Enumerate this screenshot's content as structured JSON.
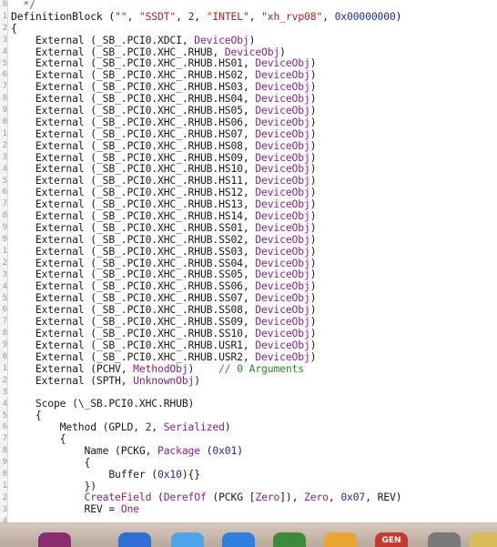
{
  "gutter_numbers": [
    "0",
    "1",
    "2",
    "3",
    "4",
    "5",
    "6",
    "7",
    "8",
    "9",
    "0",
    "1",
    "2",
    "3",
    "4",
    "5",
    "6",
    "7",
    "8",
    "9",
    "0",
    "1",
    "2",
    "3",
    "4",
    "5",
    "6",
    "7",
    "8",
    "9",
    "0",
    "1",
    "2",
    "3",
    "4",
    "5",
    "6",
    "7",
    "8",
    "9",
    "0",
    "1",
    "2",
    "3",
    "4",
    "5"
  ],
  "lines": [
    [
      {
        "t": "  */",
        "c": "comment"
      }
    ],
    [
      {
        "t": "DefinitionBlock (",
        "c": "kw"
      },
      {
        "t": "\"\"",
        "c": "str"
      },
      {
        "t": ", ",
        "c": "plain"
      },
      {
        "t": "\"SSDT\"",
        "c": "str"
      },
      {
        "t": ", ",
        "c": "plain"
      },
      {
        "t": "2",
        "c": "num"
      },
      {
        "t": ", ",
        "c": "plain"
      },
      {
        "t": "\"INTEL\"",
        "c": "str"
      },
      {
        "t": ", ",
        "c": "plain"
      },
      {
        "t": "\"xh_rvp08\"",
        "c": "str"
      },
      {
        "t": ", ",
        "c": "plain"
      },
      {
        "t": "0x00000000",
        "c": "num"
      },
      {
        "t": ")",
        "c": "plain"
      }
    ],
    [
      {
        "t": "{",
        "c": "plain"
      }
    ],
    [
      {
        "t": "    External (_SB_.PCI0.XDCI, ",
        "c": "plain"
      },
      {
        "t": "DeviceObj",
        "c": "type"
      },
      {
        "t": ")",
        "c": "plain"
      }
    ],
    [
      {
        "t": "    External (_SB_.PCI0.XHC_.RHUB, ",
        "c": "plain"
      },
      {
        "t": "DeviceObj",
        "c": "type"
      },
      {
        "t": ")",
        "c": "plain"
      }
    ],
    [
      {
        "t": "    External (_SB_.PCI0.XHC_.RHUB.HS01, ",
        "c": "plain"
      },
      {
        "t": "DeviceObj",
        "c": "type"
      },
      {
        "t": ")",
        "c": "plain"
      }
    ],
    [
      {
        "t": "    External (_SB_.PCI0.XHC_.RHUB.HS02, ",
        "c": "plain"
      },
      {
        "t": "DeviceObj",
        "c": "type"
      },
      {
        "t": ")",
        "c": "plain"
      }
    ],
    [
      {
        "t": "    External (_SB_.PCI0.XHC_.RHUB.HS03, ",
        "c": "plain"
      },
      {
        "t": "DeviceObj",
        "c": "type"
      },
      {
        "t": ")",
        "c": "plain"
      }
    ],
    [
      {
        "t": "    External (_SB_.PCI0.XHC_.RHUB.HS04, ",
        "c": "plain"
      },
      {
        "t": "DeviceObj",
        "c": "type"
      },
      {
        "t": ")",
        "c": "plain"
      }
    ],
    [
      {
        "t": "    External (_SB_.PCI0.XHC_.RHUB.HS05, ",
        "c": "plain"
      },
      {
        "t": "DeviceObj",
        "c": "type"
      },
      {
        "t": ")",
        "c": "plain"
      }
    ],
    [
      {
        "t": "    External (_SB_.PCI0.XHC_.RHUB.HS06, ",
        "c": "plain"
      },
      {
        "t": "DeviceObj",
        "c": "type"
      },
      {
        "t": ")",
        "c": "plain"
      }
    ],
    [
      {
        "t": "    External (_SB_.PCI0.XHC_.RHUB.HS07, ",
        "c": "plain"
      },
      {
        "t": "DeviceObj",
        "c": "type"
      },
      {
        "t": ")",
        "c": "plain"
      }
    ],
    [
      {
        "t": "    External (_SB_.PCI0.XHC_.RHUB.HS08, ",
        "c": "plain"
      },
      {
        "t": "DeviceObj",
        "c": "type"
      },
      {
        "t": ")",
        "c": "plain"
      }
    ],
    [
      {
        "t": "    External (_SB_.PCI0.XHC_.RHUB.HS09, ",
        "c": "plain"
      },
      {
        "t": "DeviceObj",
        "c": "type"
      },
      {
        "t": ")",
        "c": "plain"
      }
    ],
    [
      {
        "t": "    External (_SB_.PCI0.XHC_.RHUB.HS10, ",
        "c": "plain"
      },
      {
        "t": "DeviceObj",
        "c": "type"
      },
      {
        "t": ")",
        "c": "plain"
      }
    ],
    [
      {
        "t": "    External (_SB_.PCI0.XHC_.RHUB.HS11, ",
        "c": "plain"
      },
      {
        "t": "DeviceObj",
        "c": "type"
      },
      {
        "t": ")",
        "c": "plain"
      }
    ],
    [
      {
        "t": "    External (_SB_.PCI0.XHC_.RHUB.HS12, ",
        "c": "plain"
      },
      {
        "t": "DeviceObj",
        "c": "type"
      },
      {
        "t": ")",
        "c": "plain"
      }
    ],
    [
      {
        "t": "    External (_SB_.PCI0.XHC_.RHUB.HS13, ",
        "c": "plain"
      },
      {
        "t": "DeviceObj",
        "c": "type"
      },
      {
        "t": ")",
        "c": "plain"
      }
    ],
    [
      {
        "t": "    External (_SB_.PCI0.XHC_.RHUB.HS14, ",
        "c": "plain"
      },
      {
        "t": "DeviceObj",
        "c": "type"
      },
      {
        "t": ")",
        "c": "plain"
      }
    ],
    [
      {
        "t": "    External (_SB_.PCI0.XHC_.RHUB.SS01, ",
        "c": "plain"
      },
      {
        "t": "DeviceObj",
        "c": "type"
      },
      {
        "t": ")",
        "c": "plain"
      }
    ],
    [
      {
        "t": "    External (_SB_.PCI0.XHC_.RHUB.SS02, ",
        "c": "plain"
      },
      {
        "t": "DeviceObj",
        "c": "type"
      },
      {
        "t": ")",
        "c": "plain"
      }
    ],
    [
      {
        "t": "    External (_SB_.PCI0.XHC_.RHUB.SS03, ",
        "c": "plain"
      },
      {
        "t": "DeviceObj",
        "c": "type"
      },
      {
        "t": ")",
        "c": "plain"
      }
    ],
    [
      {
        "t": "    External (_SB_.PCI0.XHC_.RHUB.SS04, ",
        "c": "plain"
      },
      {
        "t": "DeviceObj",
        "c": "type"
      },
      {
        "t": ")",
        "c": "plain"
      }
    ],
    [
      {
        "t": "    External (_SB_.PCI0.XHC_.RHUB.SS05, ",
        "c": "plain"
      },
      {
        "t": "DeviceObj",
        "c": "type"
      },
      {
        "t": ")",
        "c": "plain"
      }
    ],
    [
      {
        "t": "    External (_SB_.PCI0.XHC_.RHUB.SS06, ",
        "c": "plain"
      },
      {
        "t": "DeviceObj",
        "c": "type"
      },
      {
        "t": ")",
        "c": "plain"
      }
    ],
    [
      {
        "t": "    External (_SB_.PCI0.XHC_.RHUB.SS07, ",
        "c": "plain"
      },
      {
        "t": "DeviceObj",
        "c": "type"
      },
      {
        "t": ")",
        "c": "plain"
      }
    ],
    [
      {
        "t": "    External (_SB_.PCI0.XHC_.RHUB.SS08, ",
        "c": "plain"
      },
      {
        "t": "DeviceObj",
        "c": "type"
      },
      {
        "t": ")",
        "c": "plain"
      }
    ],
    [
      {
        "t": "    External (_SB_.PCI0.XHC_.RHUB.SS09, ",
        "c": "plain"
      },
      {
        "t": "DeviceObj",
        "c": "type"
      },
      {
        "t": ")",
        "c": "plain"
      }
    ],
    [
      {
        "t": "    External (_SB_.PCI0.XHC_.RHUB.SS10, ",
        "c": "plain"
      },
      {
        "t": "DeviceObj",
        "c": "type"
      },
      {
        "t": ")",
        "c": "plain"
      }
    ],
    [
      {
        "t": "    External (_SB_.PCI0.XHC_.RHUB.USR1, ",
        "c": "plain"
      },
      {
        "t": "DeviceObj",
        "c": "type"
      },
      {
        "t": ")",
        "c": "plain"
      }
    ],
    [
      {
        "t": "    External (_SB_.PCI0.XHC_.RHUB.USR2, ",
        "c": "plain"
      },
      {
        "t": "DeviceObj",
        "c": "type"
      },
      {
        "t": ")",
        "c": "plain"
      }
    ],
    [
      {
        "t": "    External (PCHV, ",
        "c": "plain"
      },
      {
        "t": "MethodObj",
        "c": "type"
      },
      {
        "t": ")    ",
        "c": "plain"
      },
      {
        "t": "// 0 Arguments",
        "c": "comment"
      }
    ],
    [
      {
        "t": "    External (SPTH, ",
        "c": "plain"
      },
      {
        "t": "UnknownObj",
        "c": "type"
      },
      {
        "t": ")",
        "c": "plain"
      }
    ],
    [
      {
        "t": "",
        "c": "plain"
      }
    ],
    [
      {
        "t": "    Scope (\\_SB.PCI0.XHC.RHUB)",
        "c": "plain"
      }
    ],
    [
      {
        "t": "    {",
        "c": "plain"
      }
    ],
    [
      {
        "t": "        Method (GPLD, ",
        "c": "plain"
      },
      {
        "t": "2",
        "c": "num"
      },
      {
        "t": ", ",
        "c": "plain"
      },
      {
        "t": "Serialized",
        "c": "type"
      },
      {
        "t": ")",
        "c": "plain"
      }
    ],
    [
      {
        "t": "        {",
        "c": "plain"
      }
    ],
    [
      {
        "t": "            Name (PCKG, ",
        "c": "plain"
      },
      {
        "t": "Package",
        "c": "type"
      },
      {
        "t": " (",
        "c": "plain"
      },
      {
        "t": "0x01",
        "c": "num"
      },
      {
        "t": ")",
        "c": "plain"
      }
    ],
    [
      {
        "t": "            {",
        "c": "plain"
      }
    ],
    [
      {
        "t": "                Buffer (",
        "c": "plain"
      },
      {
        "t": "0x10",
        "c": "num"
      },
      {
        "t": "){}",
        "c": "plain"
      }
    ],
    [
      {
        "t": "            })",
        "c": "plain"
      }
    ],
    [
      {
        "t": "            ",
        "c": "plain"
      },
      {
        "t": "CreateField",
        "c": "type"
      },
      {
        "t": " (",
        "c": "plain"
      },
      {
        "t": "DerefOf",
        "c": "type"
      },
      {
        "t": " (PCKG [",
        "c": "plain"
      },
      {
        "t": "Zero",
        "c": "type"
      },
      {
        "t": "]), ",
        "c": "plain"
      },
      {
        "t": "Zero",
        "c": "type"
      },
      {
        "t": ", ",
        "c": "plain"
      },
      {
        "t": "0x07",
        "c": "num"
      },
      {
        "t": ", REV)",
        "c": "plain"
      }
    ],
    [
      {
        "t": "            REV = ",
        "c": "plain"
      },
      {
        "t": "One",
        "c": "type"
      }
    ]
  ],
  "dock": {
    "items": [
      {
        "name": "dock-app-1",
        "color": "#8a2d6e"
      },
      {
        "name": "dock-app-2",
        "color": "#2f6fd6"
      },
      {
        "name": "dock-app-3",
        "color": "#4ea4e8"
      },
      {
        "name": "dock-app-4",
        "color": "#2d7fe0"
      },
      {
        "name": "dock-app-5",
        "color": "#3c8a3c"
      },
      {
        "name": "dock-app-6",
        "color": "#e8a531"
      },
      {
        "name": "dock-app-7",
        "color": "#c63a2e",
        "label": "GEN"
      },
      {
        "name": "dock-app-8",
        "color": "#7a7a7a"
      },
      {
        "name": "dock-app-9",
        "color": "#d9bd5a"
      }
    ]
  }
}
